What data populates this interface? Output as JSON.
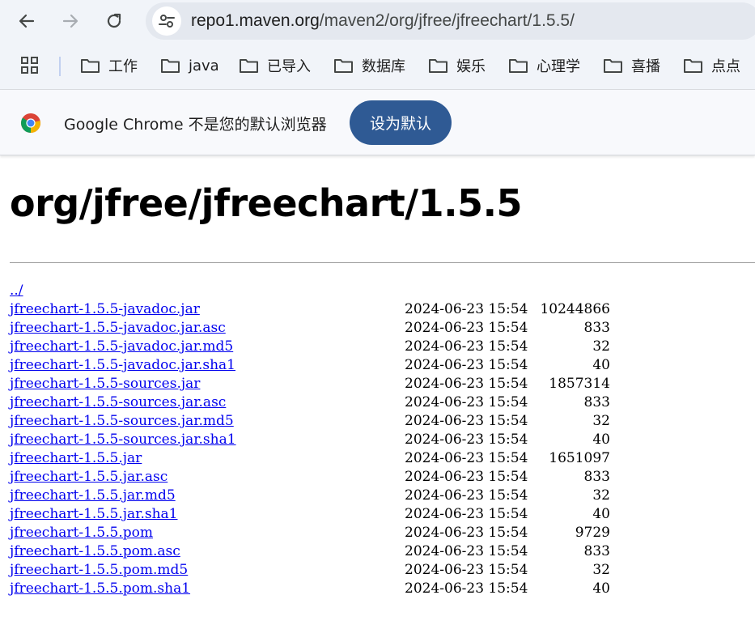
{
  "toolbar": {
    "url_host": "repo1.maven.org",
    "url_path": "/maven2/org/jfree/jfreechart/1.5.5/"
  },
  "bookmarks": [
    "工作",
    "java",
    "已导入",
    "数据库",
    "娱乐",
    "心理学",
    "喜播",
    "点点"
  ],
  "infobar": {
    "message": "Google Chrome 不是您的默认浏览器",
    "button": "设为默认"
  },
  "page": {
    "title": "org/jfree/jfreechart/1.5.5",
    "parent_link": "../",
    "files": [
      {
        "name": "jfreechart-1.5.5-javadoc.jar",
        "date": "2024-06-23 15:54",
        "size": "10244866"
      },
      {
        "name": "jfreechart-1.5.5-javadoc.jar.asc",
        "date": "2024-06-23 15:54",
        "size": "833"
      },
      {
        "name": "jfreechart-1.5.5-javadoc.jar.md5",
        "date": "2024-06-23 15:54",
        "size": "32"
      },
      {
        "name": "jfreechart-1.5.5-javadoc.jar.sha1",
        "date": "2024-06-23 15:54",
        "size": "40"
      },
      {
        "name": "jfreechart-1.5.5-sources.jar",
        "date": "2024-06-23 15:54",
        "size": "1857314"
      },
      {
        "name": "jfreechart-1.5.5-sources.jar.asc",
        "date": "2024-06-23 15:54",
        "size": "833"
      },
      {
        "name": "jfreechart-1.5.5-sources.jar.md5",
        "date": "2024-06-23 15:54",
        "size": "32"
      },
      {
        "name": "jfreechart-1.5.5-sources.jar.sha1",
        "date": "2024-06-23 15:54",
        "size": "40"
      },
      {
        "name": "jfreechart-1.5.5.jar",
        "date": "2024-06-23 15:54",
        "size": "1651097"
      },
      {
        "name": "jfreechart-1.5.5.jar.asc",
        "date": "2024-06-23 15:54",
        "size": "833"
      },
      {
        "name": "jfreechart-1.5.5.jar.md5",
        "date": "2024-06-23 15:54",
        "size": "32"
      },
      {
        "name": "jfreechart-1.5.5.jar.sha1",
        "date": "2024-06-23 15:54",
        "size": "40"
      },
      {
        "name": "jfreechart-1.5.5.pom",
        "date": "2024-06-23 15:54",
        "size": "9729"
      },
      {
        "name": "jfreechart-1.5.5.pom.asc",
        "date": "2024-06-23 15:54",
        "size": "833"
      },
      {
        "name": "jfreechart-1.5.5.pom.md5",
        "date": "2024-06-23 15:54",
        "size": "32"
      },
      {
        "name": "jfreechart-1.5.5.pom.sha1",
        "date": "2024-06-23 15:54",
        "size": "40"
      }
    ]
  },
  "colors": {
    "link": "#0000ee",
    "accent_button": "#2f5a94",
    "toolbar_bg": "#f1f4f9"
  },
  "icons": [
    "back-arrow-icon",
    "forward-arrow-icon",
    "reload-icon",
    "site-info-icon",
    "apps-grid-icon",
    "folder-icon",
    "chrome-logo-icon"
  ]
}
